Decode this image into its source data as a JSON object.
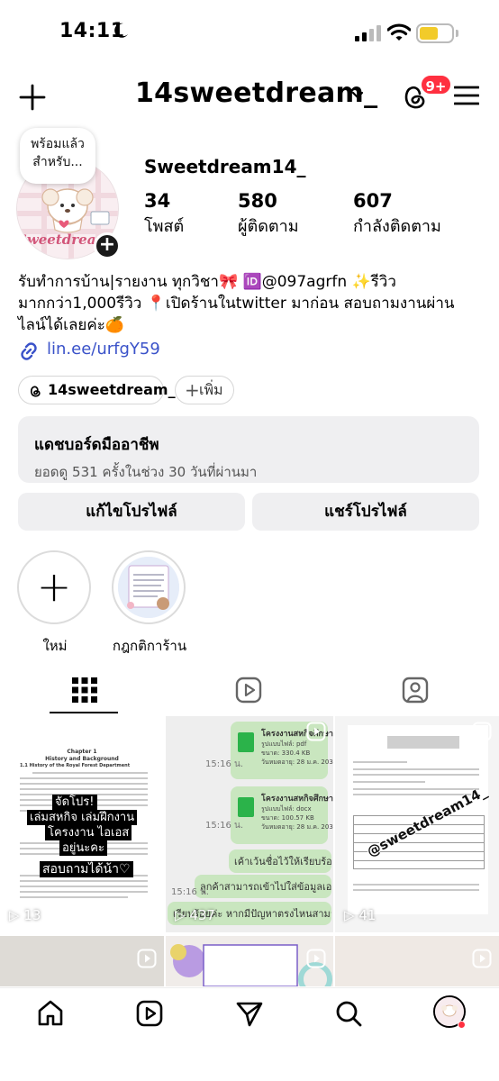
{
  "status_bar": {
    "time": "14:11",
    "battery_level": 0.6,
    "icons": [
      "moon-icon",
      "signal-icon",
      "wifi-icon",
      "battery-icon"
    ]
  },
  "header": {
    "username": "14sweetdream_",
    "notification_badge": "9+"
  },
  "profile": {
    "note": [
      "พร้อมแล้ว",
      "สำหรับ..."
    ],
    "avatar_text": "Sweetdream14",
    "display_name": "Sweetdream14_",
    "stats": [
      {
        "value": "34",
        "label": "โพสต์"
      },
      {
        "value": "580",
        "label": "ผู้ติดตาม"
      },
      {
        "value": "607",
        "label": "กำลังติดตาม"
      }
    ],
    "bio": [
      "รับทำการบ้าน|รายงาน ทุกวิชา🎀 🆔@097agrfn ✨รีวิว",
      "มากกว่า1,000รีวิว 📍เปิดร้านในtwitter มาก่อน สอบถามงานผ่าน",
      "ไลน์ได้เลยค่ะ🍊"
    ],
    "link": "lin.ee/urfgY59",
    "threads_chip": "14sweetdream_",
    "add_chip": "เพิ่ม"
  },
  "dashboard": {
    "title": "แดชบอร์ดมืออาชีพ",
    "subtitle": "ยอดดู 531 ครั้งในช่วง 30 วันที่ผ่านมา"
  },
  "actions": {
    "edit": "แก้ไขโปรไฟล์",
    "share": "แชร์โปรไฟล์"
  },
  "highlights": [
    {
      "label": "ใหม่"
    },
    {
      "label": "กฎกติการ้าน"
    }
  ],
  "tabs": [
    "grid-icon",
    "reels-icon",
    "tagged-icon"
  ],
  "posts": [
    {
      "views": "13",
      "doc_title": [
        "Chapter 1",
        "History and Background"
      ],
      "section": "1.1 History of the Royal Forest Department",
      "overlay": [
        "จัดโปร!",
        "เล่มสหกิจ เล่มฝึกงาน",
        "โครงงาน ไอเอส",
        "อยู่นะคะ",
        "สอบถามได้น้า♡"
      ]
    },
    {
      "views": "437",
      "messages": [
        {
          "text": "โครงงานสหกิจศึกษา",
          "meta": "รูปแบบไฟล์: pdf",
          "size": "ขนาด: 330.4 KB",
          "date": "วันหมดอายุ: 28 ม.ค. 2031",
          "time": "15:16 น."
        },
        {
          "text": "โครงงานสหกิจศึกษา",
          "meta": "รูปแบบไฟล์: docx",
          "size": "ขนาด: 100.57 KB",
          "date": "วันหมดอายุ: 28 ม.ค. 2031",
          "time": "15:16 น."
        }
      ],
      "chat": [
        "เค้าเว้นชื่อไว้ให้เรียบร้อยแล้ว",
        "ลูกค้าสามารถเข้าไปใส่ข้อมูลเองได้เลย",
        "เรียบร้อยค่ะ หากมีปัญหาตรงไหนสามารถทักมา"
      ],
      "chat_time": "15:16 น."
    },
    {
      "views": "41",
      "watermark": "@sweetdream14_"
    }
  ],
  "bottom_nav": [
    "home-icon",
    "reels-icon",
    "send-icon",
    "search-icon",
    "profile-avatar"
  ]
}
